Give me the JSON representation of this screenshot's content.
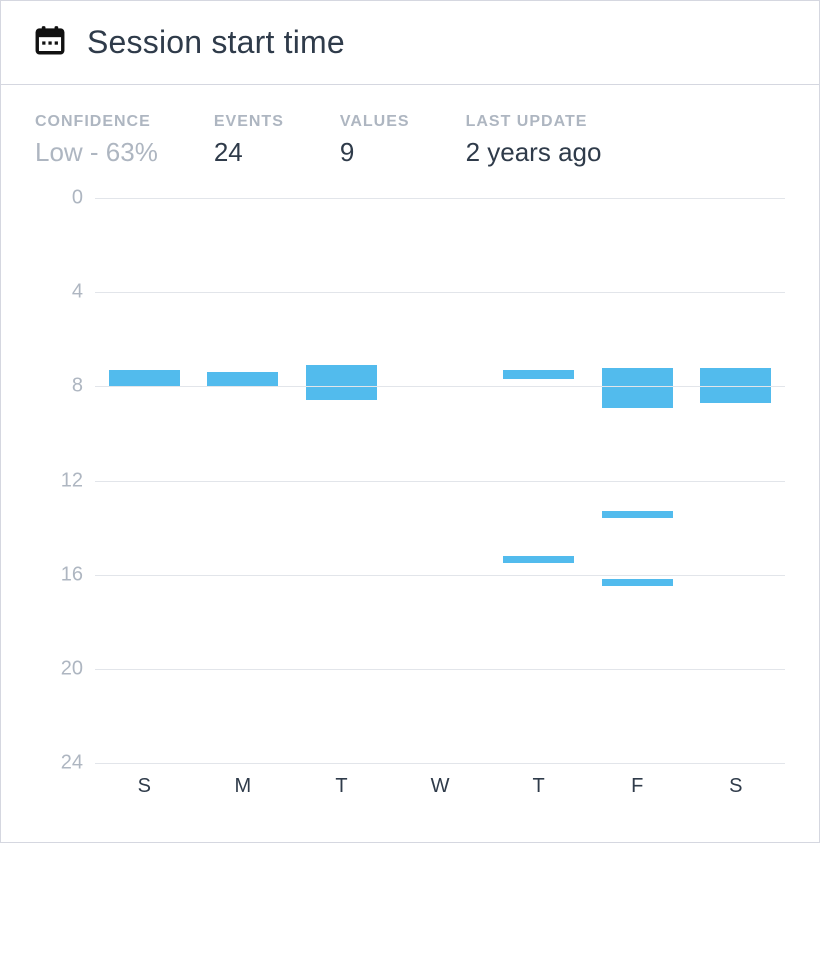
{
  "header": {
    "title": "Session start time"
  },
  "stats": {
    "confidence": {
      "label": "CONFIDENCE",
      "value": "Low - 63%"
    },
    "events": {
      "label": "EVENTS",
      "value": "24"
    },
    "values": {
      "label": "VALUES",
      "value": "9"
    },
    "last_update": {
      "label": "LAST UPDATE",
      "value": "2 years ago"
    }
  },
  "chart_data": {
    "type": "bar",
    "title": "Session start time",
    "xlabel": "",
    "ylabel": "",
    "ylim": [
      0,
      24
    ],
    "y_ticks": [
      0,
      4,
      8,
      12,
      16,
      20,
      24
    ],
    "categories": [
      "S",
      "M",
      "T",
      "W",
      "T",
      "F",
      "S"
    ],
    "series_note": "Each bar is a time-of-day range [start_hour, end_hour]; multiple ranges possible per day",
    "ranges": {
      "S": [
        [
          7.3,
          8.0
        ]
      ],
      "M": [
        [
          7.4,
          8.0
        ]
      ],
      "T": [
        [
          7.1,
          8.6
        ]
      ],
      "W": [],
      "T2": [
        [
          7.3,
          7.7
        ],
        [
          15.2,
          15.5
        ]
      ],
      "F": [
        [
          7.2,
          8.9
        ],
        [
          13.3,
          13.6
        ],
        [
          16.2,
          16.5
        ]
      ],
      "S2": [
        [
          7.2,
          8.7
        ]
      ]
    }
  },
  "colors": {
    "bar": "#52bbed",
    "grid": "#e2e5ea",
    "muted": "#aeb6c1",
    "text": "#2f3b4a"
  }
}
